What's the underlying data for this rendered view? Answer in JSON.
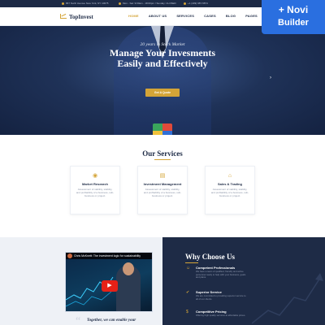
{
  "topbar": {
    "address": "867 North Avenue New York, NY 10075",
    "hours": "Mon - Sat: 9:00am - 18:00pm / Sunday: CLOSED",
    "phone": "+1 (409) 987-5874"
  },
  "brand": {
    "name": "TopInvest"
  },
  "nav": {
    "items": [
      "HOME",
      "ABOUT US",
      "SERVICES",
      "CASES",
      "BLOG",
      "PAGES",
      "CONTACTS"
    ],
    "active_index": 0
  },
  "hero": {
    "subtitle": "20 years in Stock Market",
    "title_line1": "Manage Your Invesments",
    "title_line2": "Easily and Effectively",
    "cta": "Get A Quote",
    "next_arrow": "›"
  },
  "services": {
    "title": "Our Services",
    "cards": [
      {
        "icon": "eye-icon",
        "glyph": "◉",
        "title": "Market Research",
        "desc": "Assessment of stability, stability, and profitability of a business, sub-business or project."
      },
      {
        "icon": "document-icon",
        "glyph": "▤",
        "title": "Investment Management",
        "desc": "Assessment of stability, stability, and profitability of a business, sub-business or project."
      },
      {
        "icon": "house-icon",
        "glyph": "⌂",
        "title": "Sales & Trading",
        "desc": "Assessment of stability, stability, and profitability of a business, sub-business or project."
      }
    ]
  },
  "video": {
    "title": "Chris McKnett: The investment logic for sustainability",
    "play": "▶"
  },
  "testimonial": {
    "text": "Together, we can enable your",
    "quote": "“"
  },
  "why": {
    "title": "Why Choose Us",
    "features": [
      {
        "icon": "person-icon",
        "glyph": "☺",
        "title": "Competent Professionals",
        "desc": "We have a team of qualified, friendly and active personnel ready to help with your business, goals and plans."
      },
      {
        "icon": "thumb-icon",
        "glyph": "✔",
        "title": "Superior Service",
        "desc": "We are committed to providing superior service to all of our clients."
      },
      {
        "icon": "tag-icon",
        "glyph": "$",
        "title": "Competitive Pricing",
        "desc": "Offering high quality services at affordable prices."
      }
    ]
  },
  "badge": {
    "line1": "+ Novi",
    "line2": "Builder"
  },
  "colors": {
    "accent": "#d4a437",
    "navy": "#1d2a45",
    "badge": "#2a6fe0"
  }
}
